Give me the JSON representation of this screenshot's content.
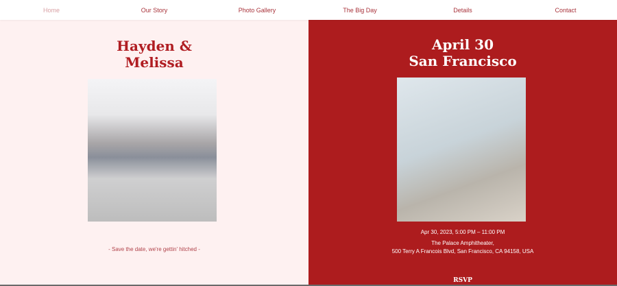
{
  "nav": [
    "Home",
    "Our Story",
    "Photo Gallery",
    "The Big Day",
    "Details",
    "Contact"
  ],
  "left": {
    "title_line1": "Hayden &",
    "title_line2": "Melissa",
    "tagline": "- Save the date, we're gettin' hitched -"
  },
  "right": {
    "title_line1": "April 30",
    "title_line2": "San Francisco",
    "datetime": "Apr 30, 2023, 5:00 PM – 11:00 PM",
    "venue": "The Palace Amphitheater,",
    "address": "500 Terry A Francois Blvd, San Francisco, CA 94158, USA",
    "rsvp": "RSVP"
  }
}
